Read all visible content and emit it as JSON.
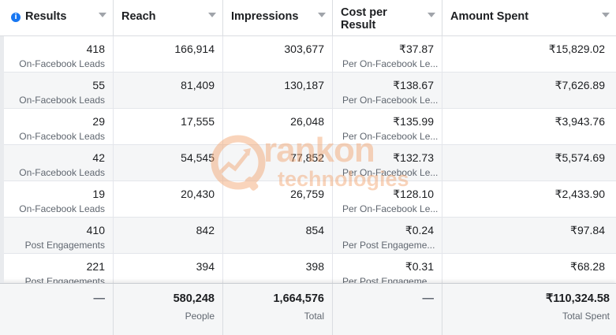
{
  "columns": {
    "results": "Results",
    "reach": "Reach",
    "impressions": "Impressions",
    "cost_line1": "Cost per",
    "cost_line2": "Result",
    "amount": "Amount Spent"
  },
  "rows": [
    {
      "results": "418",
      "results_sub": "On-Facebook Leads",
      "reach": "166,914",
      "impressions": "303,677",
      "cost": "₹37.87",
      "cost_sub": "Per On-Facebook Le...",
      "amount": "₹15,829.02"
    },
    {
      "results": "55",
      "results_sub": "On-Facebook Leads",
      "reach": "81,409",
      "impressions": "130,187",
      "cost": "₹138.67",
      "cost_sub": "Per On-Facebook Le...",
      "amount": "₹7,626.89"
    },
    {
      "results": "29",
      "results_sub": "On-Facebook Leads",
      "reach": "17,555",
      "impressions": "26,048",
      "cost": "₹135.99",
      "cost_sub": "Per On-Facebook Le...",
      "amount": "₹3,943.76"
    },
    {
      "results": "42",
      "results_sub": "On-Facebook Leads",
      "reach": "54,545",
      "impressions": "77,852",
      "cost": "₹132.73",
      "cost_sub": "Per On-Facebook Le...",
      "amount": "₹5,574.69"
    },
    {
      "results": "19",
      "results_sub": "On-Facebook Leads",
      "reach": "20,430",
      "impressions": "26,759",
      "cost": "₹128.10",
      "cost_sub": "Per On-Facebook Le...",
      "amount": "₹2,433.90"
    },
    {
      "results": "410",
      "results_sub": "Post Engagements",
      "reach": "842",
      "impressions": "854",
      "cost": "₹0.24",
      "cost_sub": "Per Post Engageme...",
      "amount": "₹97.84"
    },
    {
      "results": "221",
      "results_sub": "Post Engagements",
      "reach": "394",
      "impressions": "398",
      "cost": "₹0.31",
      "cost_sub": "Per Post Engageme...",
      "amount": "₹68.28"
    }
  ],
  "totals": {
    "results": "—",
    "reach": "580,248",
    "reach_sub": "People",
    "impressions": "1,664,576",
    "impressions_sub": "Total",
    "cost": "—",
    "amount": "₹110,324.58",
    "amount_sub": "Total Spent"
  },
  "watermark": {
    "line1": "rankon",
    "line2": "technologies",
    "color": "#f2a26b"
  },
  "icons": {
    "info": "info-icon",
    "sort": "chevron-down-icon"
  }
}
